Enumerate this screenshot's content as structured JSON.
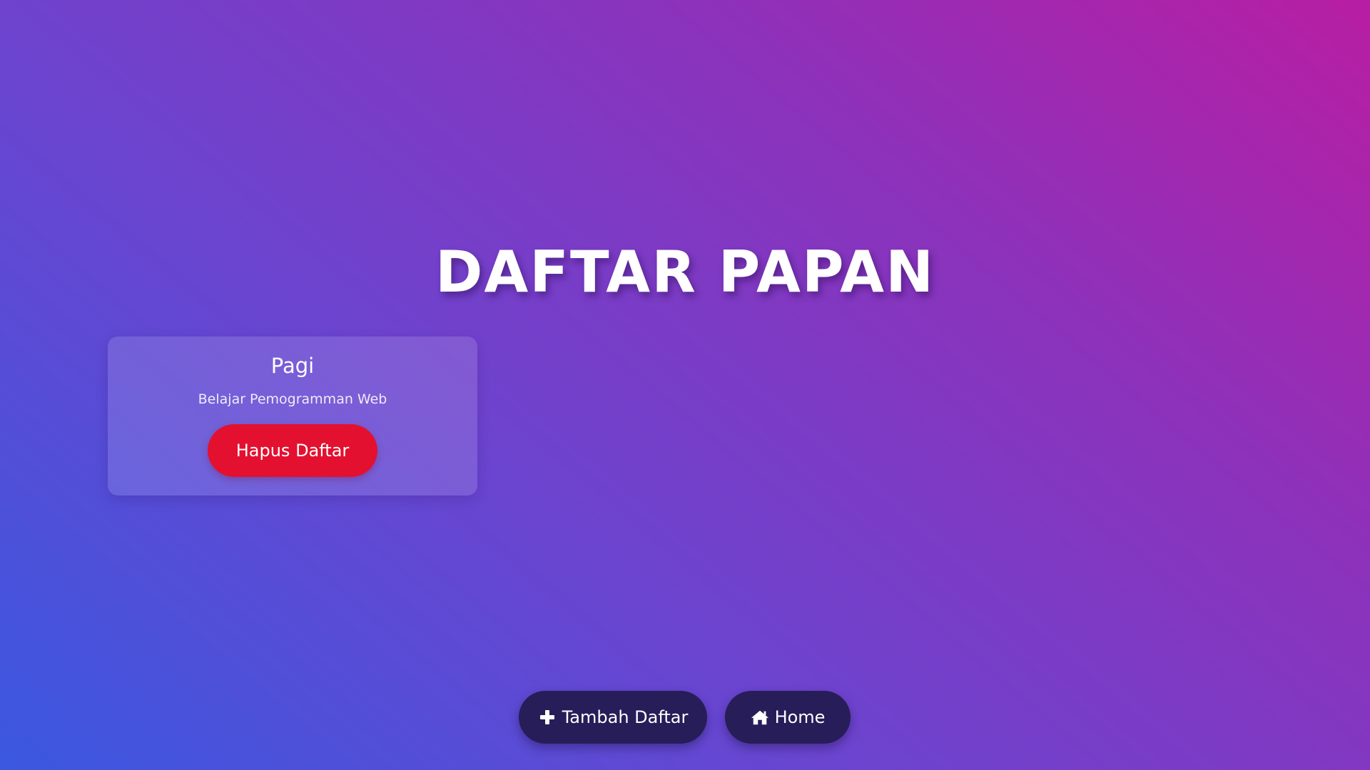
{
  "page": {
    "title": "DAFTAR PAPAN"
  },
  "boards": [
    {
      "title": "Pagi",
      "description": "Belajar Pemogramman Web",
      "delete_label": "Hapus Daftar"
    }
  ],
  "actions": {
    "add_label": "Tambah Daftar",
    "add_icon": "plus-icon",
    "home_label": "Home",
    "home_icon": "home-icon"
  },
  "colors": {
    "delete_button": "#e3112f",
    "action_button": "#271d58",
    "gradient_start": "#3b58e0",
    "gradient_end": "#b81ea3"
  }
}
